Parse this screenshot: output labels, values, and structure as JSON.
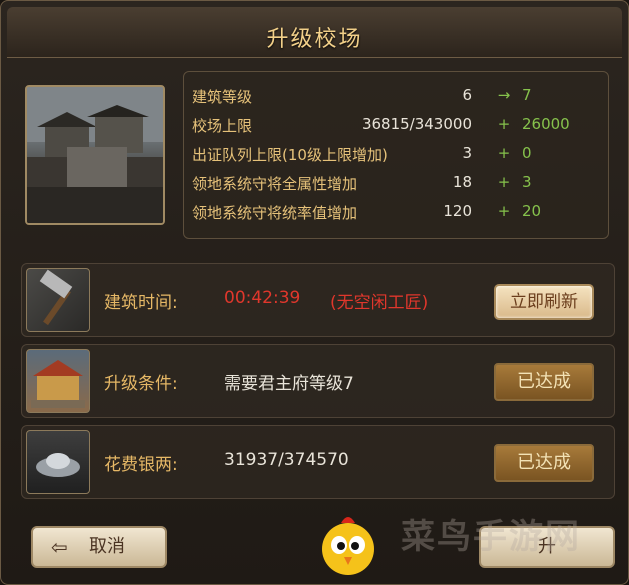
{
  "window": {
    "title": "升级校场"
  },
  "stats": [
    {
      "label": "建筑等级",
      "current": "6",
      "sign": "→",
      "next": "7"
    },
    {
      "label": "校场上限",
      "current": "36815/343000",
      "sign": "+",
      "next": "26000"
    },
    {
      "label": "出证队列上限(10级上限增加)",
      "current": "3",
      "sign": "+",
      "next": "0"
    },
    {
      "label": "领地系统守将全属性增加",
      "current": "18",
      "sign": "+",
      "next": "3"
    },
    {
      "label": "领地系统守将统率值增加",
      "current": "120",
      "sign": "+",
      "next": "20"
    }
  ],
  "build_time": {
    "label": "建筑时间:",
    "value": "00:42:39",
    "note": "(无空闲工匠)",
    "button": "立即刷新"
  },
  "condition": {
    "label": "升级条件:",
    "value": "需要君主府等级7",
    "status": "已达成"
  },
  "cost": {
    "label": "花费银两:",
    "value": "31937/374570",
    "status": "已达成"
  },
  "footer": {
    "cancel": "取消",
    "confirm_partial": "升"
  },
  "watermark": "菜鸟手游网",
  "colors": {
    "gold_text": "#e6c27a",
    "green": "#86c24c",
    "red": "#e0372c"
  }
}
